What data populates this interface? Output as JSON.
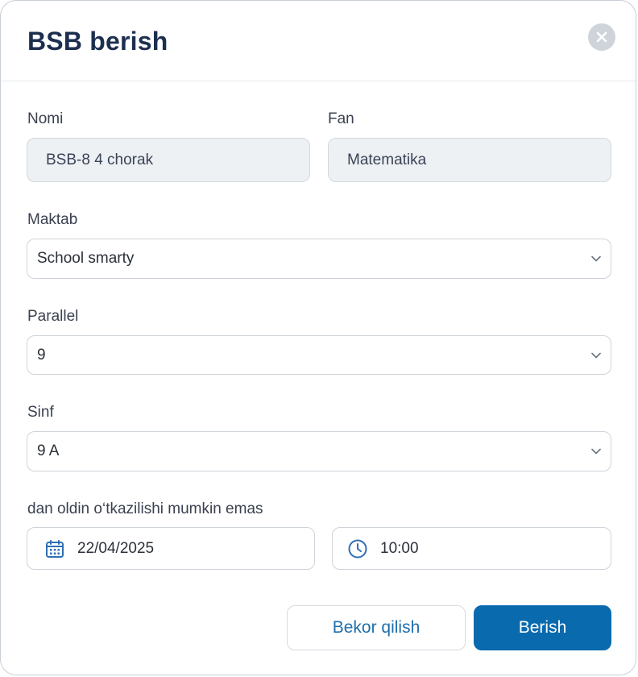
{
  "dialog": {
    "title": "BSB berish"
  },
  "form": {
    "nomi": {
      "label": "Nomi",
      "value": "BSB-8 4 chorak"
    },
    "fan": {
      "label": "Fan",
      "value": "Matematika"
    },
    "maktab": {
      "label": "Maktab",
      "value": "School smarty"
    },
    "parallel": {
      "label": "Parallel",
      "value": "9"
    },
    "sinf": {
      "label": "Sinf",
      "value": "9 A"
    },
    "deadline": {
      "label": "dan oldin o‘tkazilishi mumkin emas",
      "date": "22/04/2025",
      "time": "10:00"
    }
  },
  "actions": {
    "cancel_label": "Bekor qilish",
    "submit_label": "Berish"
  },
  "colors": {
    "primary": "#0a6aae",
    "title": "#1d2f4f",
    "icon_blue": "#2f6fb4"
  },
  "icons": {
    "close": "close-icon",
    "calendar": "calendar-icon",
    "clock": "clock-icon",
    "chevron": "chevron-down-icon"
  }
}
